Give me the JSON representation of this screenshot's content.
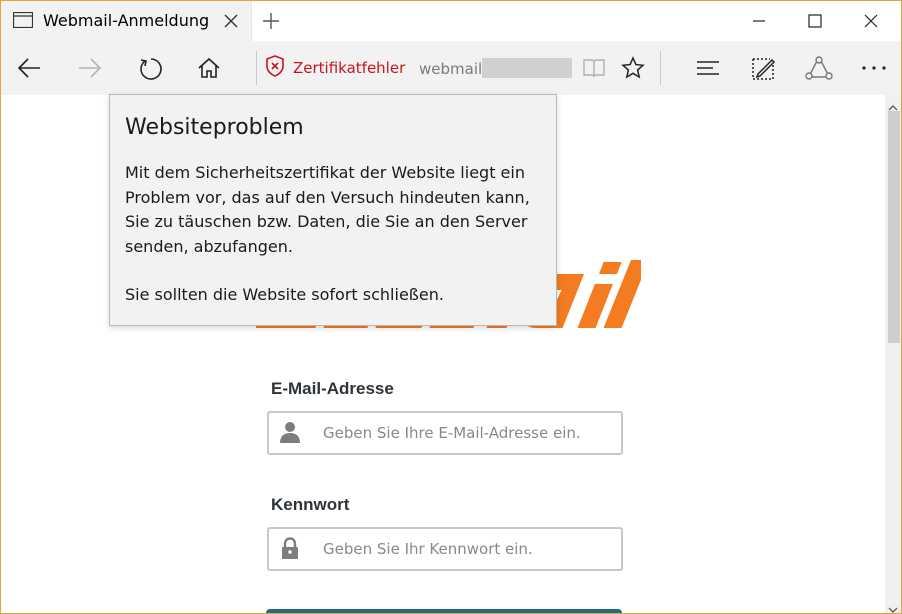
{
  "browser": {
    "tab": {
      "title": "Webmail-Anmeldung"
    },
    "address_bar": {
      "cert_status": "Zertifikatfehler",
      "url_visible": "webmail"
    }
  },
  "cert_popup": {
    "title": "Websiteproblem",
    "body": "Mit dem Sicherheitszertifikat der Website liegt ein Problem vor, das auf den Versuch hindeuten kann, Sie zu täuschen bzw. Daten, die Sie an den Server senden, abzufangen.",
    "advice": "Sie sollten die Website sofort schließen."
  },
  "login": {
    "logo_color": "#f47b20",
    "email": {
      "label": "E-Mail-Adresse",
      "placeholder": "Geben Sie Ihre E-Mail-Adresse ein.",
      "value": ""
    },
    "password": {
      "label": "Kennwort",
      "placeholder": "Geben Sie Ihr Kennwort ein.",
      "value": ""
    }
  },
  "colors": {
    "error_red": "#c5161d",
    "window_border": "#e8a33d",
    "button_teal": "#1d6a86"
  },
  "icons": {
    "tab": "browser-tab-icon",
    "close_tab": "close-icon",
    "new_tab": "plus-icon",
    "back": "arrow-left-icon",
    "forward": "arrow-right-icon",
    "refresh": "refresh-icon",
    "home": "home-icon",
    "cert": "shield-x-icon",
    "reading_view": "book-icon",
    "favorite": "star-icon",
    "hub": "hub-icon",
    "notes": "web-note-icon",
    "share": "share-icon",
    "more": "more-dots-icon"
  }
}
